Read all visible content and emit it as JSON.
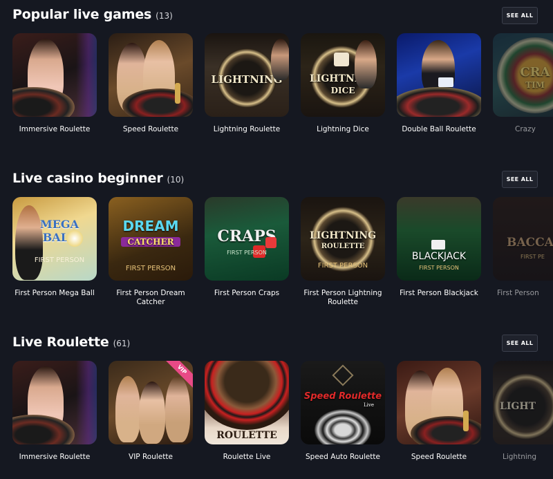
{
  "sections": [
    {
      "title": "Popular live games",
      "count": "(13)",
      "see_all": "SEE ALL",
      "tiles": [
        {
          "label": "Immersive Roulette"
        },
        {
          "label": "Speed Roulette"
        },
        {
          "label": "Lightning Roulette",
          "art_text": "LIGHTNING"
        },
        {
          "label": "Lightning Dice",
          "art_text": "LIGHTNING",
          "art_sub": "DICE"
        },
        {
          "label": "Double Ball Roulette"
        },
        {
          "label": "Crazy",
          "art_text": "CRA",
          "art_sub": "TIM"
        }
      ]
    },
    {
      "title": "Live casino beginner",
      "count": "(10)",
      "see_all": "SEE ALL",
      "tiles": [
        {
          "label": "First Person Mega Ball",
          "art_text": "MEGA BALL",
          "art_sub": "FIRST PERSON"
        },
        {
          "label": "First Person Dream Catcher",
          "art_text": "DREAM",
          "art_sub": "CATCHER",
          "art_fp": "FIRST PERSON"
        },
        {
          "label": "First Person Craps",
          "art_text": "CRAPS",
          "art_fp": "FIRST PERSON"
        },
        {
          "label": "First Person Lightning Roulette",
          "art_text": "LIGHTNING",
          "art_sub": "ROULETTE",
          "art_fp": "FIRST PERSON"
        },
        {
          "label": "First Person Blackjack",
          "art_text": "BLACKJACK",
          "art_fp": "FIRST PERSON"
        },
        {
          "label": "First Person",
          "art_text": "BACCA",
          "art_fp": "FIRST PE"
        }
      ]
    },
    {
      "title": "Live Roulette",
      "count": "(61)",
      "see_all": "SEE ALL",
      "tiles": [
        {
          "label": "Immersive Roulette"
        },
        {
          "label": "VIP Roulette",
          "badge": "VIP"
        },
        {
          "label": "Roulette Live",
          "art_text": "ROULETTE"
        },
        {
          "label": "Speed Auto Roulette",
          "art_text": "Speed Roulette",
          "art_sub": "Live"
        },
        {
          "label": "Speed Roulette"
        },
        {
          "label": "Lightning",
          "art_text": "LIGHT"
        }
      ]
    }
  ]
}
